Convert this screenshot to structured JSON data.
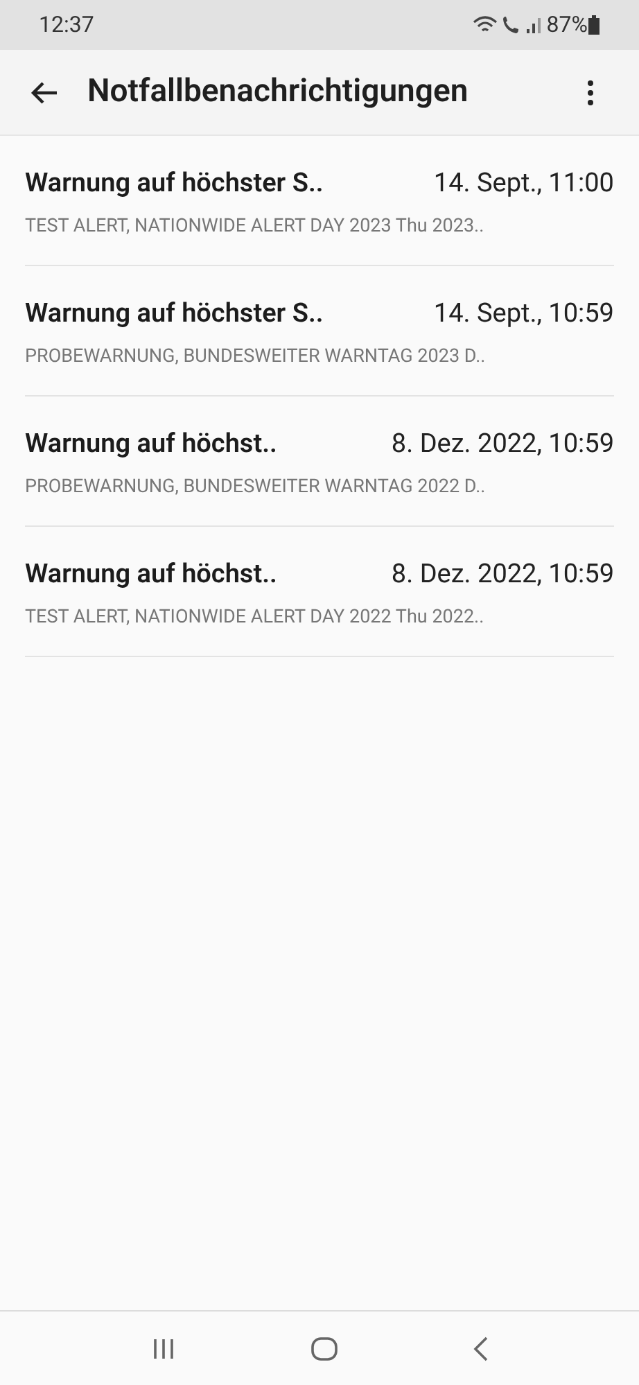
{
  "status_bar": {
    "time": "12:37",
    "battery": "87%"
  },
  "app_bar": {
    "title": "Notfallbenachrichtigungen"
  },
  "alerts": [
    {
      "title": "Warnung auf höchster S..",
      "time": "14. Sept., 11:00",
      "preview": "TEST ALERT, NATIONWIDE ALERT DAY 2023 Thu 2023.."
    },
    {
      "title": "Warnung auf höchster S..",
      "time": "14. Sept., 10:59",
      "preview": "PROBEWARNUNG, BUNDESWEITER WARNTAG 2023 D.."
    },
    {
      "title": "Warnung auf höchst..",
      "time": "8. Dez. 2022, 10:59",
      "preview": "PROBEWARNUNG, BUNDESWEITER WARNTAG 2022 D.."
    },
    {
      "title": "Warnung auf höchst..",
      "time": "8. Dez. 2022, 10:59",
      "preview": "TEST ALERT, NATIONWIDE ALERT DAY 2022 Thu 2022.."
    }
  ]
}
